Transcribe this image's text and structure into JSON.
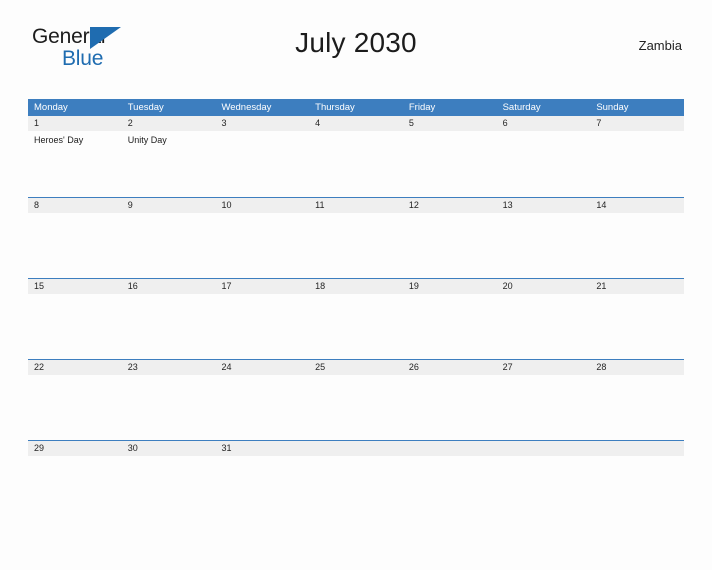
{
  "brand": {
    "name_part1": "General",
    "name_part2": "Blue",
    "flag_icon": "triangle-flag-icon",
    "accent_color": "#1f6cb0"
  },
  "header": {
    "title": "July 2030",
    "country": "Zambia"
  },
  "colors": {
    "header_blue": "#3d7ebf",
    "date_strip_gray": "#efefef",
    "cell_white": "#fdfdfd",
    "page_background": "#fdfdfd",
    "text_dark": "#1c1c1c"
  },
  "calendar": {
    "month": "July",
    "year": "2030",
    "weekdays": [
      "Monday",
      "Tuesday",
      "Wednesday",
      "Thursday",
      "Friday",
      "Saturday",
      "Sunday"
    ],
    "weeks": [
      {
        "days": [
          {
            "number": "1",
            "events": [
              "Heroes' Day"
            ]
          },
          {
            "number": "2",
            "events": [
              "Unity Day"
            ]
          },
          {
            "number": "3",
            "events": []
          },
          {
            "number": "4",
            "events": []
          },
          {
            "number": "5",
            "events": []
          },
          {
            "number": "6",
            "events": []
          },
          {
            "number": "7",
            "events": []
          }
        ]
      },
      {
        "days": [
          {
            "number": "8",
            "events": []
          },
          {
            "number": "9",
            "events": []
          },
          {
            "number": "10",
            "events": []
          },
          {
            "number": "11",
            "events": []
          },
          {
            "number": "12",
            "events": []
          },
          {
            "number": "13",
            "events": []
          },
          {
            "number": "14",
            "events": []
          }
        ]
      },
      {
        "days": [
          {
            "number": "15",
            "events": []
          },
          {
            "number": "16",
            "events": []
          },
          {
            "number": "17",
            "events": []
          },
          {
            "number": "18",
            "events": []
          },
          {
            "number": "19",
            "events": []
          },
          {
            "number": "20",
            "events": []
          },
          {
            "number": "21",
            "events": []
          }
        ]
      },
      {
        "days": [
          {
            "number": "22",
            "events": []
          },
          {
            "number": "23",
            "events": []
          },
          {
            "number": "24",
            "events": []
          },
          {
            "number": "25",
            "events": []
          },
          {
            "number": "26",
            "events": []
          },
          {
            "number": "27",
            "events": []
          },
          {
            "number": "28",
            "events": []
          }
        ]
      },
      {
        "days": [
          {
            "number": "29",
            "events": []
          },
          {
            "number": "30",
            "events": []
          },
          {
            "number": "31",
            "events": []
          },
          {
            "number": "",
            "events": []
          },
          {
            "number": "",
            "events": []
          },
          {
            "number": "",
            "events": []
          },
          {
            "number": "",
            "events": []
          }
        ]
      }
    ]
  }
}
